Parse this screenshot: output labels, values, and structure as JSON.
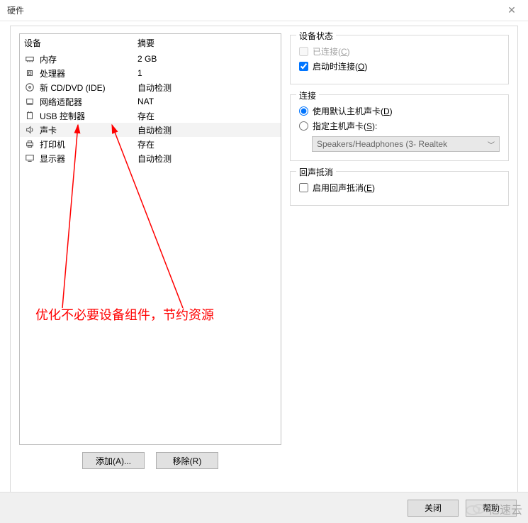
{
  "title": "硬件",
  "headers": {
    "device": "设备",
    "summary": "摘要"
  },
  "devices": [
    {
      "name": "内存",
      "summary": "2 GB",
      "icon": "memory"
    },
    {
      "name": "处理器",
      "summary": "1",
      "icon": "cpu"
    },
    {
      "name": "新 CD/DVD (IDE)",
      "summary": "自动检测",
      "icon": "cd"
    },
    {
      "name": "网络适配器",
      "summary": "NAT",
      "icon": "network"
    },
    {
      "name": "USB 控制器",
      "summary": "存在",
      "icon": "usb"
    },
    {
      "name": "声卡",
      "summary": "自动检测",
      "icon": "sound",
      "selected": true
    },
    {
      "name": "打印机",
      "summary": "存在",
      "icon": "printer"
    },
    {
      "name": "显示器",
      "summary": "自动检测",
      "icon": "display"
    }
  ],
  "annotation": "优化不必要设备组件，节约资源",
  "buttons": {
    "add": "添加(A)...",
    "remove": "移除(R)",
    "close": "关闭",
    "help": "帮助"
  },
  "groups": {
    "status": {
      "legend": "设备状态",
      "connected": {
        "label": "已连接(",
        "key": "C",
        "suffix": ")"
      },
      "startup": {
        "label": "启动时连接(",
        "key": "O",
        "suffix": ")"
      }
    },
    "connection": {
      "legend": "连接",
      "default": {
        "label": "使用默认主机声卡(",
        "key": "D",
        "suffix": ")"
      },
      "specify": {
        "label": "指定主机声卡(",
        "key": "S",
        "suffix": "):"
      },
      "combo": "Speakers/Headphones (3- Realtek"
    },
    "echo": {
      "legend": "回声抵消",
      "enable": {
        "label": "启用回声抵消(",
        "key": "E",
        "suffix": ")"
      }
    }
  },
  "watermark": "亿速云"
}
